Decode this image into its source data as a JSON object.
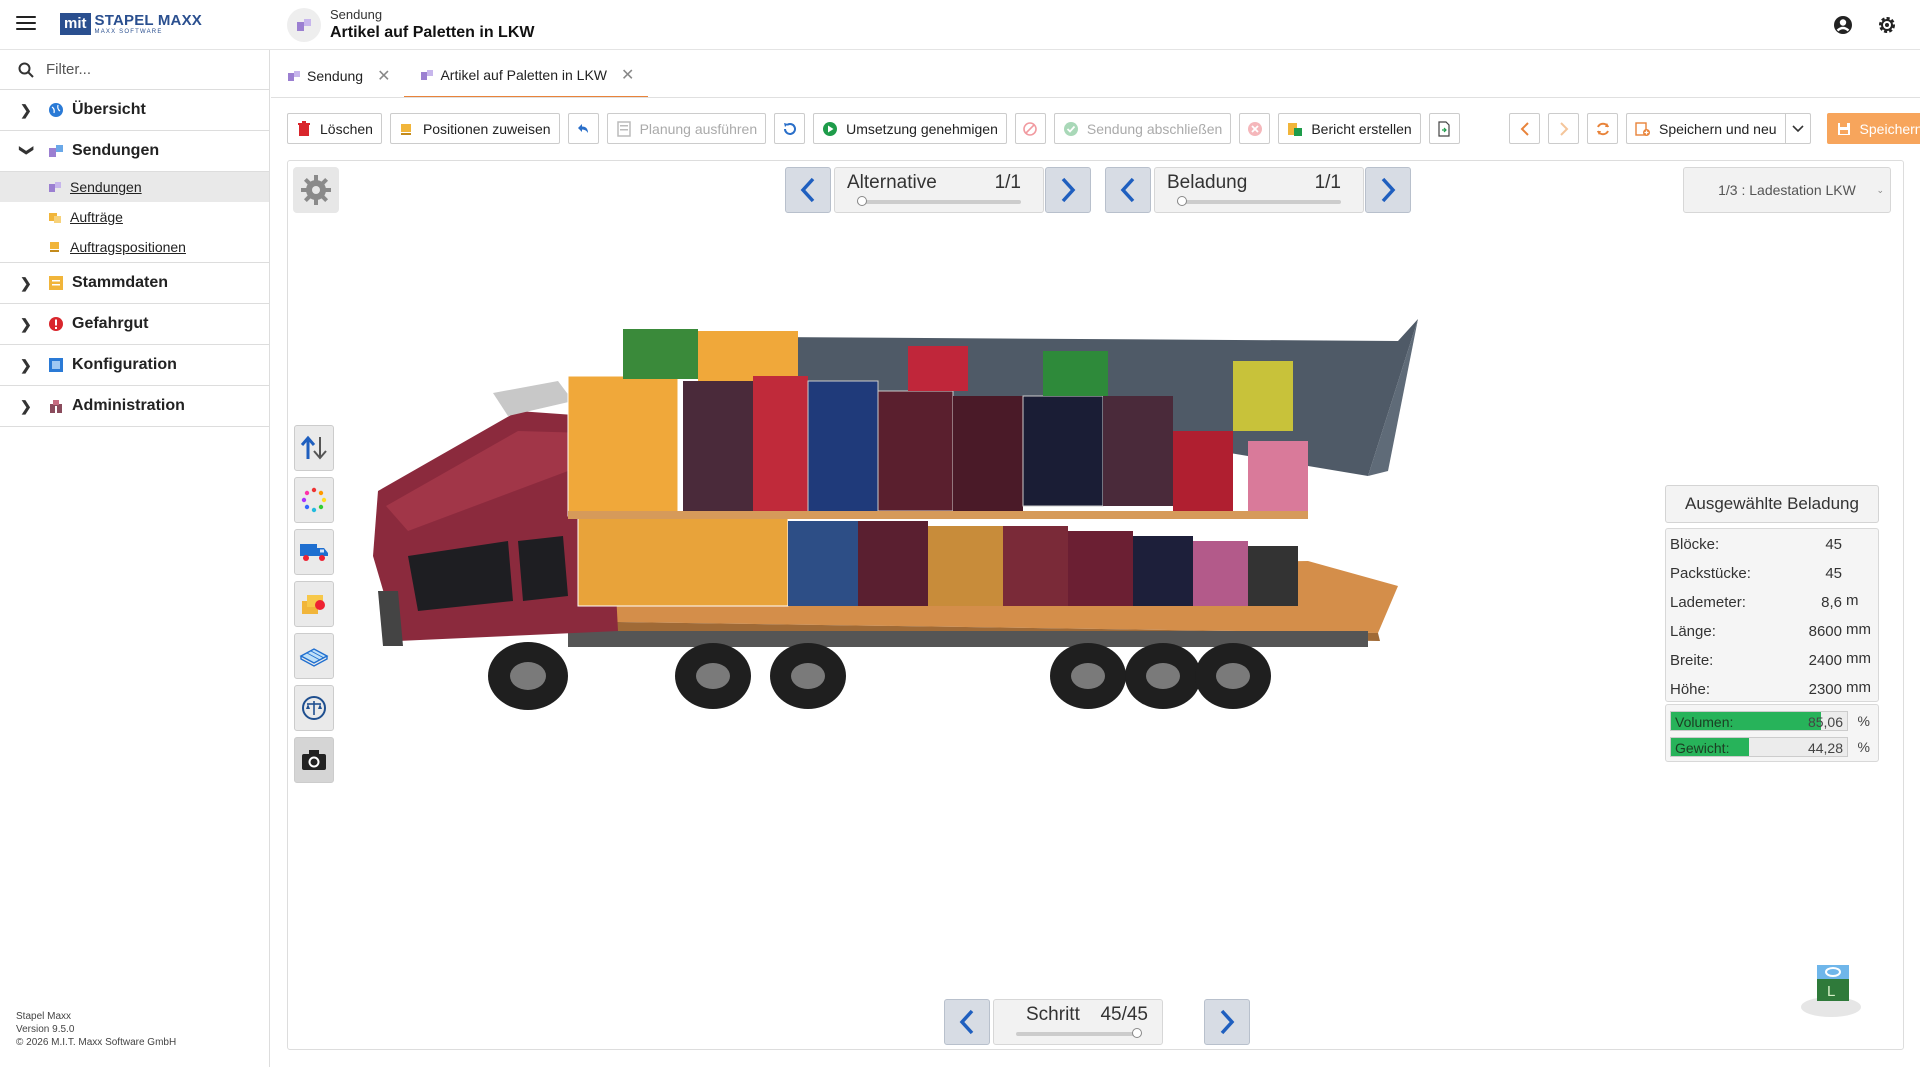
{
  "header": {
    "logo_box": "mit",
    "logo_main": "STAPEL MAXX",
    "logo_sub": "MAXX SOFTWARE",
    "title_small": "Sendung",
    "title_big": "Artikel auf Paletten in LKW",
    "icons": [
      "menu-icon",
      "account-icon",
      "settings-icon"
    ]
  },
  "sidebar": {
    "filter_placeholder": "Filter...",
    "items": [
      {
        "label": "Übersicht",
        "icon": "globe-icon",
        "expanded": false
      },
      {
        "label": "Sendungen",
        "icon": "shipments-icon",
        "expanded": true,
        "children": [
          {
            "label": "Sendungen",
            "icon": "shipments-icon",
            "active": true
          },
          {
            "label": "Aufträge",
            "icon": "orders-icon",
            "active": false
          },
          {
            "label": "Auftragspositionen",
            "icon": "order-items-icon",
            "active": false
          }
        ]
      },
      {
        "label": "Stammdaten",
        "icon": "masterdata-icon",
        "expanded": false
      },
      {
        "label": "Gefahrgut",
        "icon": "warning-icon",
        "expanded": false
      },
      {
        "label": "Konfiguration",
        "icon": "config-icon",
        "expanded": false
      },
      {
        "label": "Administration",
        "icon": "admin-icon",
        "expanded": false
      }
    ],
    "version_lines": [
      "Stapel Maxx",
      "Version 9.5.0",
      "© 2026 M.I.T. Maxx Software GmbH"
    ]
  },
  "tabs": [
    {
      "label": "Sendung",
      "active": false
    },
    {
      "label": "Artikel auf Paletten in LKW",
      "active": true
    }
  ],
  "toolbar": {
    "delete": "Löschen",
    "assign": "Positionen zuweisen",
    "plan": "Planung ausführen",
    "approve": "Umsetzung genehmigen",
    "complete": "Sendung abschließen",
    "report": "Bericht erstellen",
    "save_new": "Speichern und neu",
    "save": "Speichern"
  },
  "viewer": {
    "alternative": {
      "label": "Alternative",
      "value": "1/1"
    },
    "loading": {
      "label": "Beladung",
      "value": "1/1"
    },
    "station": "1/3 : Ladestation LKW",
    "step": {
      "label": "Schritt",
      "value": "45/45"
    },
    "cube_label": "L"
  },
  "stats": {
    "title": "Ausgewählte Beladung",
    "rows": [
      {
        "key": "Blöcke:",
        "value": "45",
        "unit": ""
      },
      {
        "key": "Packstücke:",
        "value": "45",
        "unit": ""
      },
      {
        "key": "Lademeter:",
        "value": "8,6",
        "unit": "m"
      },
      {
        "key": "Länge:",
        "value": "8600",
        "unit": "mm"
      },
      {
        "key": "Breite:",
        "value": "2400",
        "unit": "mm"
      },
      {
        "key": "Höhe:",
        "value": "2300",
        "unit": "mm"
      }
    ],
    "volume": {
      "label": "Volumen:",
      "value": "85,06",
      "unit": "%",
      "fraction": 0.8506
    },
    "weight": {
      "label": "Gewicht:",
      "value": "44,28",
      "unit": "%",
      "fraction": 0.4428
    }
  },
  "colors": {
    "accent": "#e8833a",
    "brand": "#2a4f8f",
    "progress": "#27b35a"
  }
}
